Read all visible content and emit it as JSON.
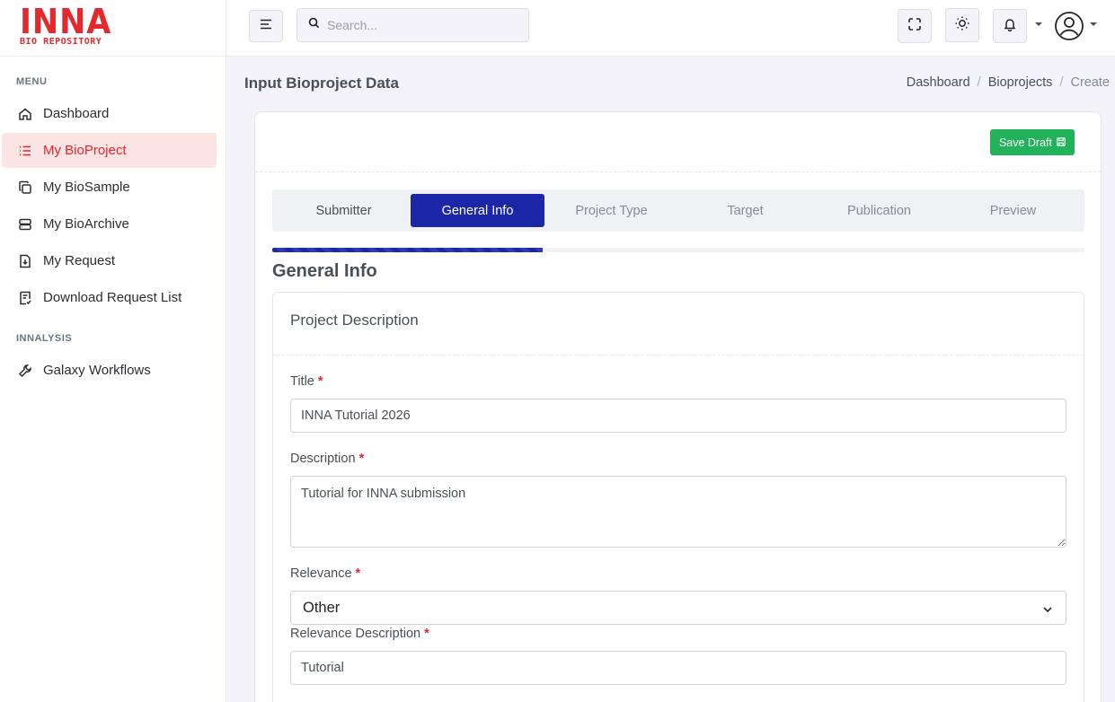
{
  "brand": {
    "name": "INNA",
    "tagline": "BIO REPOSITORY"
  },
  "sidebar": {
    "sections": [
      {
        "title": "MENU"
      },
      {
        "title": "INNALYSIS"
      }
    ],
    "items": [
      {
        "label": "Dashboard",
        "icon": "home-icon"
      },
      {
        "label": "My BioProject",
        "icon": "list-icon",
        "active": true
      },
      {
        "label": "My BioSample",
        "icon": "copy-icon"
      },
      {
        "label": "My BioArchive",
        "icon": "server-icon"
      },
      {
        "label": "My Request",
        "icon": "file-download-icon"
      },
      {
        "label": "Download Request List",
        "icon": "file-list-icon"
      },
      {
        "label": "Galaxy Workflows",
        "icon": "tools-icon"
      }
    ]
  },
  "topbar": {
    "search_placeholder": "Search...",
    "icons": [
      "menu-icon",
      "search-icon",
      "fullscreen-icon",
      "sun-icon",
      "bell-icon",
      "user-avatar-icon"
    ]
  },
  "page": {
    "title": "Input Bioproject Data",
    "breadcrumb": [
      "Dashboard",
      "Bioprojects",
      "Create"
    ]
  },
  "toolbar": {
    "save_label": "Save Draft"
  },
  "steps": [
    {
      "label": "Submitter",
      "state": "done"
    },
    {
      "label": "General Info",
      "state": "active"
    },
    {
      "label": "Project Type",
      "state": "pending"
    },
    {
      "label": "Target",
      "state": "pending"
    },
    {
      "label": "Publication",
      "state": "pending"
    },
    {
      "label": "Preview",
      "state": "pending"
    }
  ],
  "progress_fraction": 0.333,
  "section": {
    "title": "General Info",
    "card_title": "Project Description"
  },
  "form": {
    "title": {
      "label": "Title",
      "value": "INNA Tutorial 2026"
    },
    "description": {
      "label": "Description",
      "value": "Tutorial for INNA submission"
    },
    "relevance": {
      "label": "Relevance",
      "value": "Other"
    },
    "relevance_description": {
      "label": "Relevance Description",
      "value": "Tutorial"
    },
    "required_mark": "*"
  },
  "colors": {
    "brand_red": "#e4282c",
    "active_step": "#1c27a8",
    "save_green": "#22b35a",
    "active_nav_bg": "#fde4e4"
  }
}
